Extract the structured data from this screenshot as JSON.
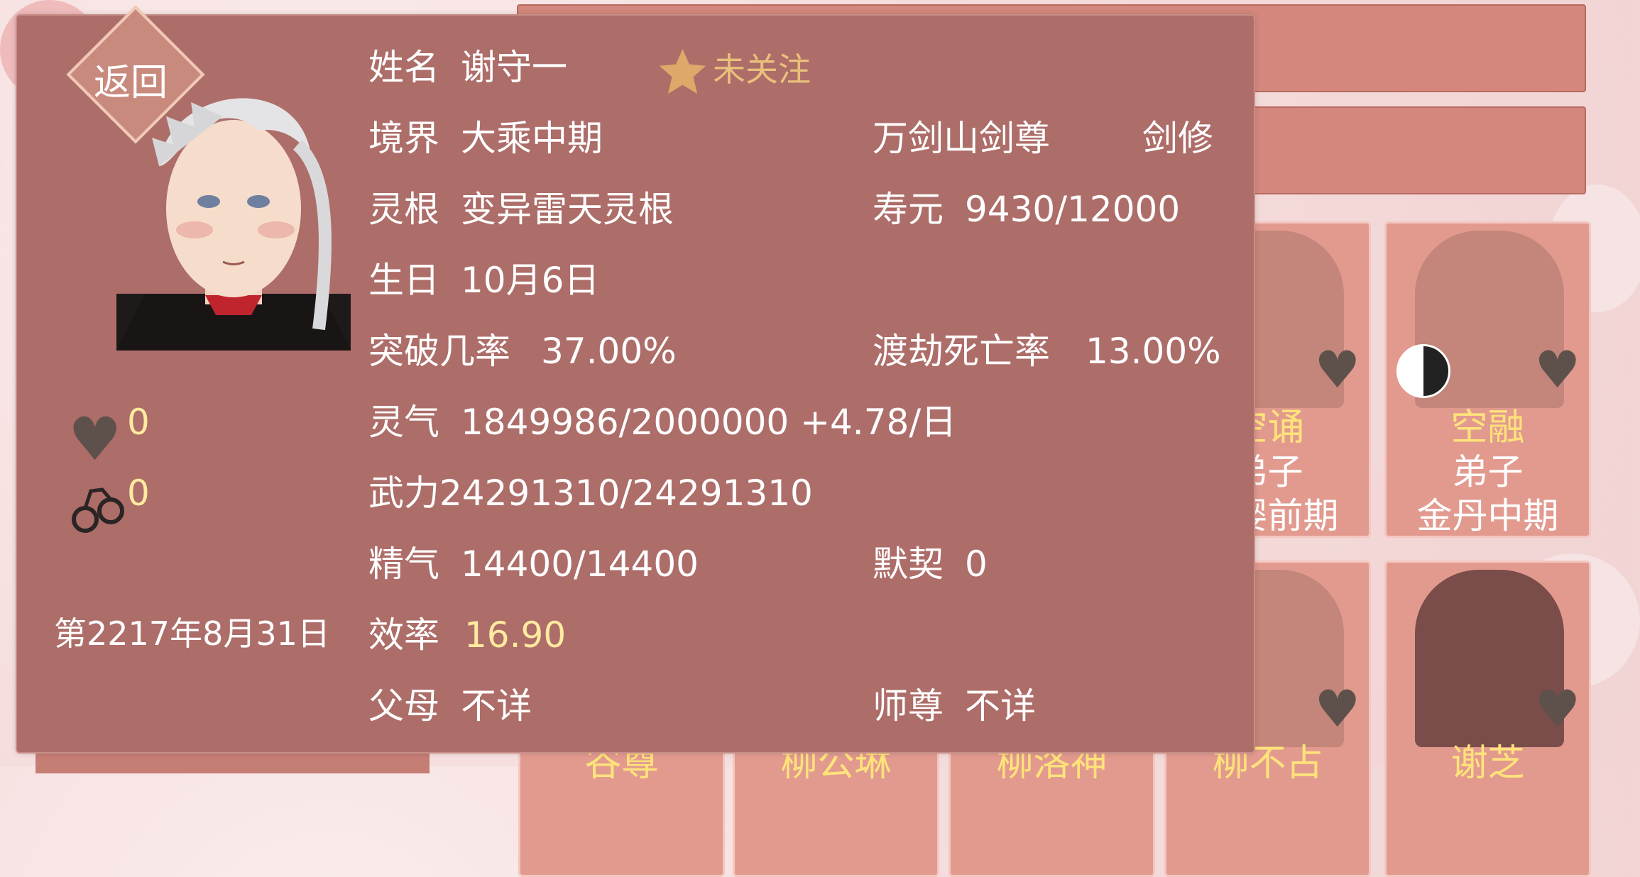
{
  "back_button": {
    "label": "返回"
  },
  "character": {
    "name_label": "姓名",
    "name": "谢守一",
    "follow_label": "未关注",
    "realm_label": "境界",
    "realm": "大乘中期",
    "title": "万剑山剑尊",
    "class": "剑修",
    "root_label": "灵根",
    "root": "变异雷天灵根",
    "lifespan_label": "寿元",
    "lifespan": "9430/12000",
    "birthday_label": "生日",
    "birthday": "10月6日",
    "breakthrough_label": "突破几率",
    "breakthrough": "37.00%",
    "tribulation_label": "渡劫死亡率",
    "tribulation": "13.00%",
    "qi_label": "灵气",
    "qi": "1849986/2000000 +4.78/日",
    "force": "武力24291310/24291310",
    "essence_label": "精气",
    "essence": "14400/14400",
    "bond_label": "默契",
    "bond": "0",
    "efficiency_label": "效率",
    "efficiency": "16.90",
    "parents_label": "父母",
    "parents": "不详",
    "master_label": "师尊",
    "master": "不详"
  },
  "stats": {
    "favor": "0",
    "captive": "0"
  },
  "date": "第2217年8月31日",
  "icons": {
    "favor": "heart-icon",
    "captive": "handcuffs-icon",
    "follow": "star-icon",
    "card_heart": "heart-icon",
    "yinyang": "yinyang-icon"
  },
  "cards": [
    {
      "name": "空诵",
      "role": "弟子",
      "realm": "元婴前期"
    },
    {
      "name": "空融",
      "role": "弟子",
      "realm": "金丹中期"
    },
    {
      "name": "谷尊"
    },
    {
      "name": "柳公琳"
    },
    {
      "name": "柳洛神"
    },
    {
      "name": "柳不占"
    },
    {
      "name": "谢芝"
    }
  ],
  "colors": {
    "panel": "#ad6d69",
    "highlight": "#ffeaa0",
    "star": "#e0b060"
  }
}
